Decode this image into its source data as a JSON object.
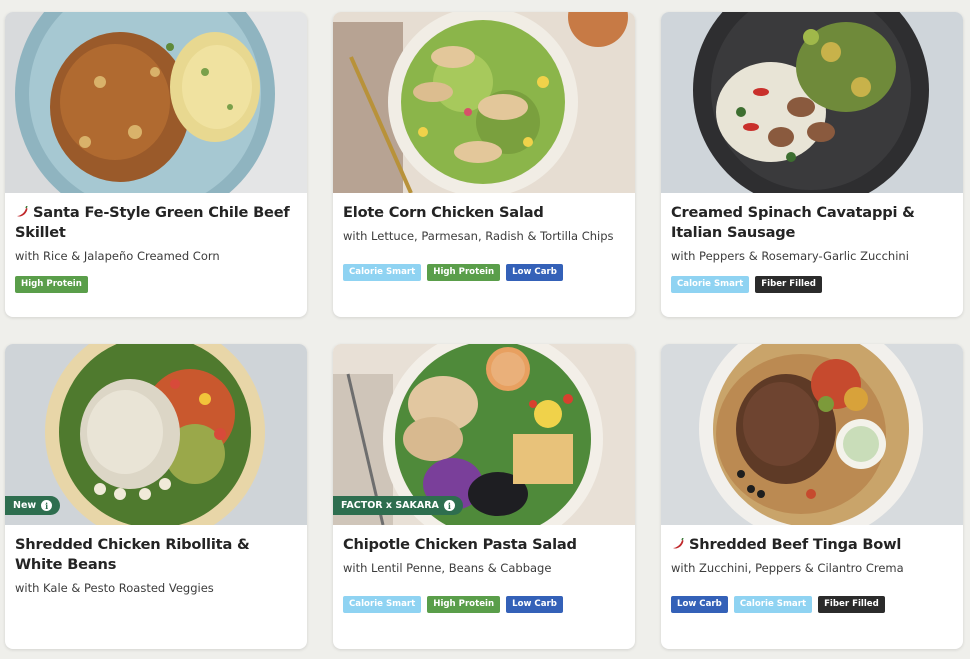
{
  "colors": {
    "high_protein": "#5a9e4a",
    "calorie_smart": "#8fd3f2",
    "low_carb": "#3461b8",
    "fiber_filled": "#2b2b2b",
    "badge": "#2e6e4f",
    "pepper": "#c0282b"
  },
  "meals": [
    {
      "title": "Santa Fe-Style Green Chile Beef Skillet",
      "subtitle": "with Rice & Jalapeño Creamed Corn",
      "spicy_icon": "chili-pepper-icon",
      "tags": [
        {
          "label": "High Protein",
          "type": "high_protein"
        }
      ]
    },
    {
      "title": "Elote Corn Chicken Salad",
      "subtitle": "with Lettuce, Parmesan, Radish & Tortilla Chips",
      "tags": [
        {
          "label": "Calorie Smart",
          "type": "calorie_smart"
        },
        {
          "label": "High Protein",
          "type": "high_protein"
        },
        {
          "label": "Low Carb",
          "type": "low_carb"
        }
      ]
    },
    {
      "title": "Creamed Spinach Cavatappi & Italian Sausage",
      "subtitle": "with Peppers & Rosemary-Garlic Zucchini",
      "tags": [
        {
          "label": "Calorie Smart",
          "type": "calorie_smart"
        },
        {
          "label": "Fiber Filled",
          "type": "fiber_filled"
        }
      ]
    },
    {
      "title": "Shredded Chicken Ribollita & White Beans",
      "subtitle": "with Kale & Pesto Roasted Veggies",
      "badge": "New",
      "tags": []
    },
    {
      "title": "Chipotle Chicken Pasta Salad",
      "subtitle": "with Lentil Penne, Beans & Cabbage",
      "badge": "FACTOR x SAKARA",
      "tags": [
        {
          "label": "Calorie Smart",
          "type": "calorie_smart"
        },
        {
          "label": "High Protein",
          "type": "high_protein"
        },
        {
          "label": "Low Carb",
          "type": "low_carb"
        }
      ]
    },
    {
      "title": "Shredded Beef Tinga Bowl",
      "subtitle": "with Zucchini, Peppers & Cilantro Crema",
      "spicy_icon": "chili-pepper-icon",
      "tags": [
        {
          "label": "Low Carb",
          "type": "low_carb"
        },
        {
          "label": "Calorie Smart",
          "type": "calorie_smart"
        },
        {
          "label": "Fiber Filled",
          "type": "fiber_filled"
        }
      ]
    }
  ]
}
